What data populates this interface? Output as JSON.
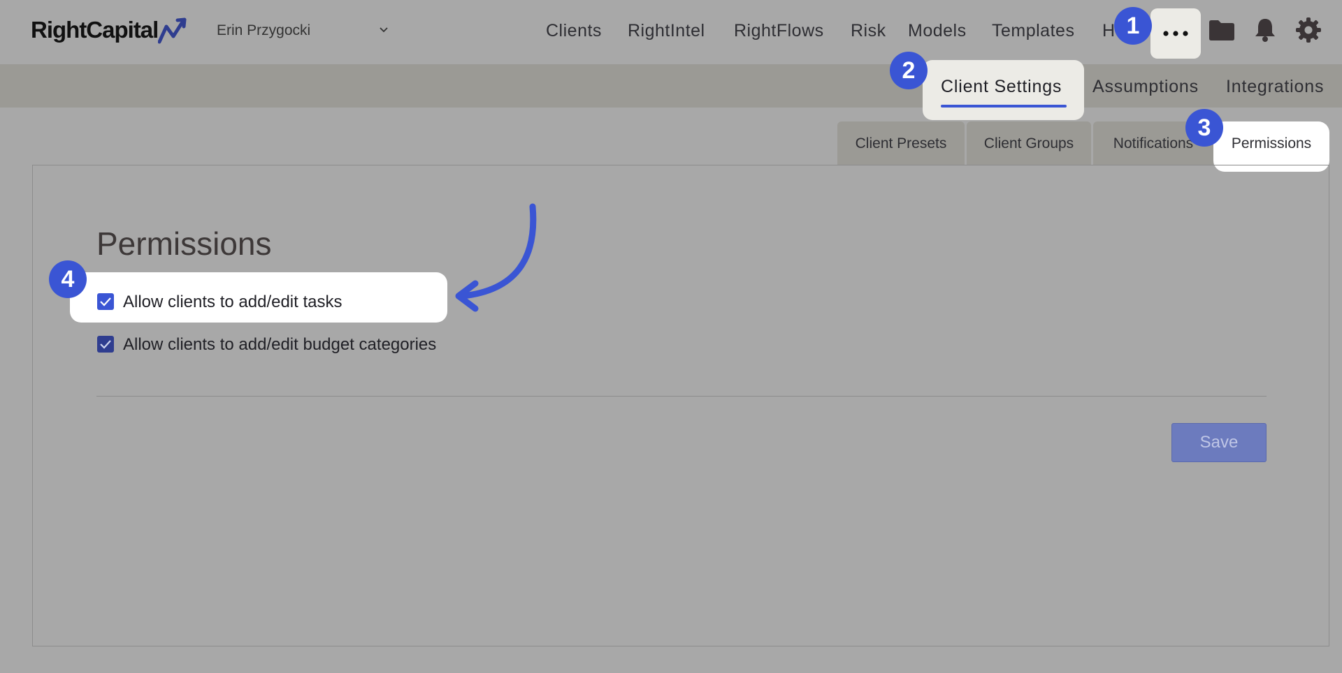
{
  "header": {
    "logo_text": "RightCapital",
    "client_name": "Erin Przygocki",
    "nav": [
      "Clients",
      "RightIntel",
      "RightFlows",
      "Risk",
      "Models",
      "Templates",
      "H"
    ],
    "icons": [
      "more-dots-icon",
      "folder-icon",
      "bell-icon",
      "gear-icon"
    ]
  },
  "subnav": {
    "active": "Client Settings",
    "items": [
      "Assumptions",
      "Integrations"
    ]
  },
  "tabs": {
    "items": [
      "Client Presets",
      "Client Groups",
      "Notifications"
    ],
    "active": "Permissions"
  },
  "main": {
    "title": "Permissions",
    "checkboxes": [
      {
        "label": "Allow clients to add/edit tasks",
        "checked": true
      },
      {
        "label": "Allow clients to add/edit budget categories",
        "checked": true
      }
    ],
    "save_label": "Save"
  },
  "annotations": {
    "badges": [
      "1",
      "2",
      "3",
      "4"
    ]
  },
  "colors": {
    "accent": "#3a55d4",
    "checkbox": "#2f3d8f",
    "save_button": "#6c7bbe",
    "overlay_gray": "#a8a8a8"
  }
}
